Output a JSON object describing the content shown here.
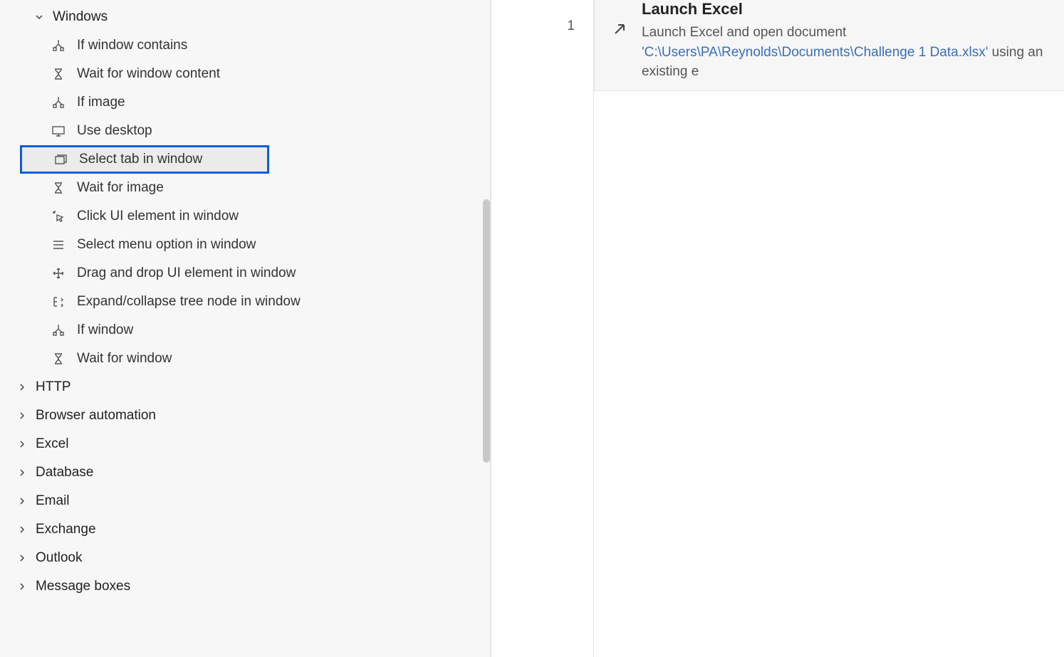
{
  "sidebar": {
    "windows_group": "Windows",
    "actions": [
      {
        "id": "if-window-contains",
        "label": "If window contains",
        "icon": "branch-icon"
      },
      {
        "id": "wait-window-content",
        "label": "Wait for window content",
        "icon": "hourglass-icon"
      },
      {
        "id": "if-image",
        "label": "If image",
        "icon": "branch-icon"
      },
      {
        "id": "use-desktop",
        "label": "Use desktop",
        "icon": "desktop-icon"
      },
      {
        "id": "select-tab",
        "label": "Select tab in window",
        "icon": "tabs-icon",
        "highlighted": true
      },
      {
        "id": "wait-image",
        "label": "Wait for image",
        "icon": "hourglass-icon"
      },
      {
        "id": "click-ui",
        "label": "Click UI element in window",
        "icon": "click-icon"
      },
      {
        "id": "select-menu",
        "label": "Select menu option in window",
        "icon": "menu-icon"
      },
      {
        "id": "drag-drop",
        "label": "Drag and drop UI element in window",
        "icon": "drag-icon"
      },
      {
        "id": "expand-tree",
        "label": "Expand/collapse tree node in window",
        "icon": "tree-icon"
      },
      {
        "id": "if-window",
        "label": "If window",
        "icon": "branch-icon"
      },
      {
        "id": "wait-window",
        "label": "Wait for window",
        "icon": "hourglass-icon"
      }
    ],
    "groups": [
      {
        "id": "http",
        "label": "HTTP"
      },
      {
        "id": "browser",
        "label": "Browser automation"
      },
      {
        "id": "excel",
        "label": "Excel"
      },
      {
        "id": "database",
        "label": "Database"
      },
      {
        "id": "email",
        "label": "Email"
      },
      {
        "id": "exchange",
        "label": "Exchange"
      },
      {
        "id": "outlook",
        "label": "Outlook"
      },
      {
        "id": "message-boxes",
        "label": "Message boxes"
      }
    ]
  },
  "flow": {
    "step_number": "1",
    "step_title": "Launch Excel",
    "step_desc_pre": "Launch Excel and open document ",
    "step_path": "'C:\\Users\\PA\\Reynolds\\Documents\\Challenge 1 Data.xlsx'",
    "step_desc_post": " using an existing e"
  }
}
